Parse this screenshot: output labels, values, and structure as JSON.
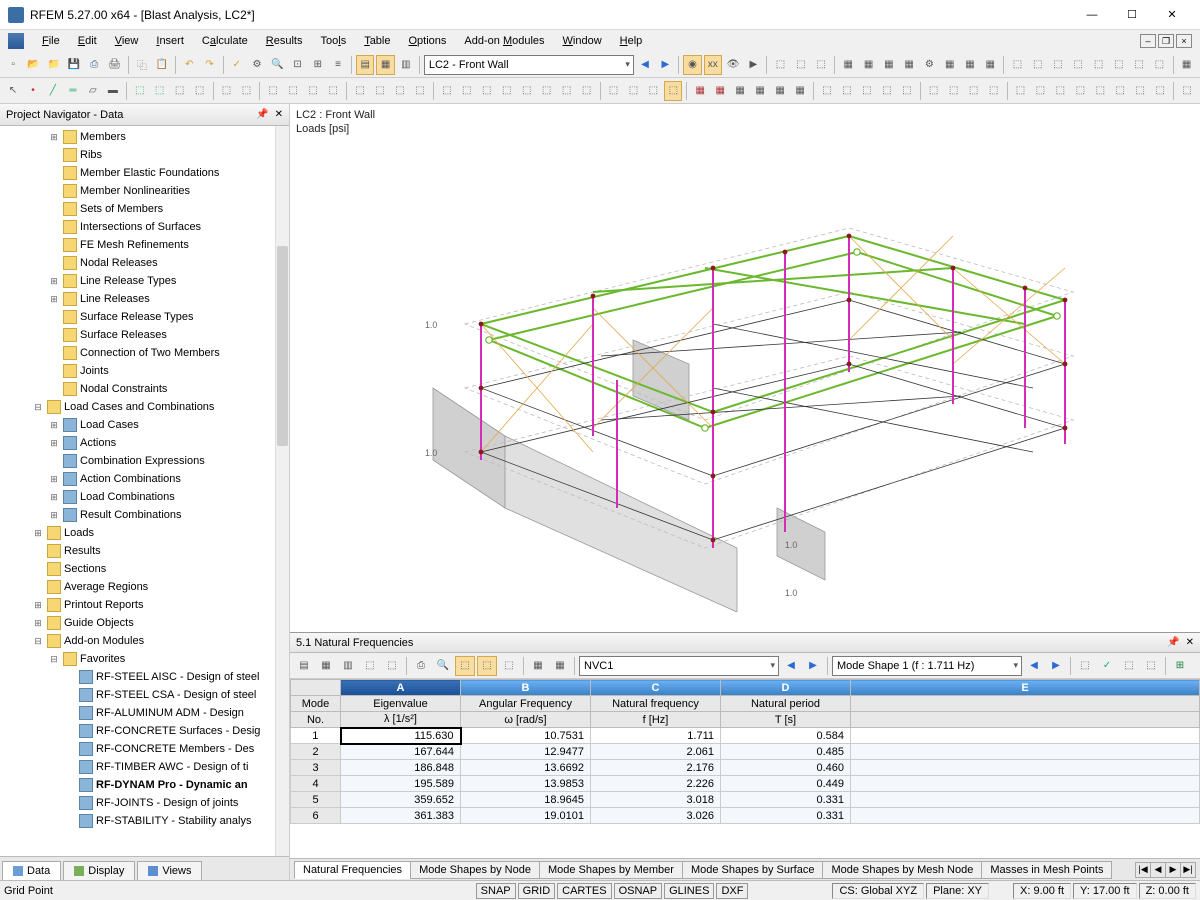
{
  "window": {
    "title": "RFEM 5.27.00 x64 - [Blast Analysis, LC2*]"
  },
  "menu": [
    "File",
    "Edit",
    "View",
    "Insert",
    "Calculate",
    "Results",
    "Tools",
    "Table",
    "Options",
    "Add-on Modules",
    "Window",
    "Help"
  ],
  "toolbar1_combo": "LC2 - Front Wall",
  "nav": {
    "title": "Project Navigator - Data",
    "items": [
      {
        "d": 3,
        "e": "+",
        "t": "Members"
      },
      {
        "d": 3,
        "e": "",
        "t": "Ribs"
      },
      {
        "d": 3,
        "e": "",
        "t": "Member Elastic Foundations"
      },
      {
        "d": 3,
        "e": "",
        "t": "Member Nonlinearities"
      },
      {
        "d": 3,
        "e": "",
        "t": "Sets of Members"
      },
      {
        "d": 3,
        "e": "",
        "t": "Intersections of Surfaces"
      },
      {
        "d": 3,
        "e": "",
        "t": "FE Mesh Refinements"
      },
      {
        "d": 3,
        "e": "",
        "t": "Nodal Releases"
      },
      {
        "d": 3,
        "e": "+",
        "t": "Line Release Types"
      },
      {
        "d": 3,
        "e": "+",
        "t": "Line Releases"
      },
      {
        "d": 3,
        "e": "",
        "t": "Surface Release Types"
      },
      {
        "d": 3,
        "e": "",
        "t": "Surface Releases"
      },
      {
        "d": 3,
        "e": "",
        "t": "Connection of Two Members"
      },
      {
        "d": 3,
        "e": "",
        "t": "Joints"
      },
      {
        "d": 3,
        "e": "",
        "t": "Nodal Constraints"
      },
      {
        "d": 2,
        "e": "-",
        "t": "Load Cases and Combinations"
      },
      {
        "d": 3,
        "e": "+",
        "t": "Load Cases",
        "m": true
      },
      {
        "d": 3,
        "e": "+",
        "t": "Actions",
        "m": true
      },
      {
        "d": 3,
        "e": "",
        "t": "Combination Expressions",
        "m": true
      },
      {
        "d": 3,
        "e": "+",
        "t": "Action Combinations",
        "m": true
      },
      {
        "d": 3,
        "e": "+",
        "t": "Load Combinations",
        "m": true
      },
      {
        "d": 3,
        "e": "+",
        "t": "Result Combinations",
        "m": true
      },
      {
        "d": 2,
        "e": "+",
        "t": "Loads"
      },
      {
        "d": 2,
        "e": "",
        "t": "Results"
      },
      {
        "d": 2,
        "e": "",
        "t": "Sections"
      },
      {
        "d": 2,
        "e": "",
        "t": "Average Regions"
      },
      {
        "d": 2,
        "e": "+",
        "t": "Printout Reports"
      },
      {
        "d": 2,
        "e": "+",
        "t": "Guide Objects"
      },
      {
        "d": 2,
        "e": "-",
        "t": "Add-on Modules"
      },
      {
        "d": 3,
        "e": "-",
        "t": "Favorites"
      },
      {
        "d": 4,
        "e": "",
        "t": "RF-STEEL AISC - Design of steel",
        "m": true
      },
      {
        "d": 4,
        "e": "",
        "t": "RF-STEEL CSA - Design of steel",
        "m": true
      },
      {
        "d": 4,
        "e": "",
        "t": "RF-ALUMINUM ADM - Design",
        "m": true
      },
      {
        "d": 4,
        "e": "",
        "t": "RF-CONCRETE Surfaces - Desig",
        "m": true
      },
      {
        "d": 4,
        "e": "",
        "t": "RF-CONCRETE Members - Des",
        "m": true
      },
      {
        "d": 4,
        "e": "",
        "t": "RF-TIMBER AWC - Design of ti",
        "m": true
      },
      {
        "d": 4,
        "e": "",
        "t": "RF-DYNAM Pro - Dynamic an",
        "m": true,
        "bold": true
      },
      {
        "d": 4,
        "e": "",
        "t": "RF-JOINTS - Design of joints",
        "m": true
      },
      {
        "d": 4,
        "e": "",
        "t": "RF-STABILITY - Stability analys",
        "m": true
      }
    ],
    "tabs": [
      "Data",
      "Display",
      "Views"
    ]
  },
  "viewport": {
    "label1": "LC2 : Front Wall",
    "label2": "Loads [psi]",
    "axis_vals": [
      "1.0",
      "1.0",
      "1.0",
      "1.0"
    ]
  },
  "panel": {
    "title": "5.1 Natural Frequencies",
    "combo1": "NVC1",
    "combo2": "Mode Shape 1 (f : 1.711 Hz)",
    "cols_top": [
      "A",
      "B",
      "C",
      "D",
      "E"
    ],
    "h1": [
      "Mode",
      "Eigenvalue",
      "Angular Frequency",
      "Natural frequency",
      "Natural period",
      ""
    ],
    "h2": [
      "No.",
      "λ [1/s²]",
      "ω [rad/s]",
      "f [Hz]",
      "T [s]",
      ""
    ],
    "rows": [
      {
        "n": "1",
        "a": "115.630",
        "b": "10.7531",
        "c": "1.711",
        "d": "0.584"
      },
      {
        "n": "2",
        "a": "167.644",
        "b": "12.9477",
        "c": "2.061",
        "d": "0.485"
      },
      {
        "n": "3",
        "a": "186.848",
        "b": "13.6692",
        "c": "2.176",
        "d": "0.460"
      },
      {
        "n": "4",
        "a": "195.589",
        "b": "13.9853",
        "c": "2.226",
        "d": "0.449"
      },
      {
        "n": "5",
        "a": "359.652",
        "b": "18.9645",
        "c": "3.018",
        "d": "0.331"
      },
      {
        "n": "6",
        "a": "361.383",
        "b": "19.0101",
        "c": "3.026",
        "d": "0.331"
      }
    ],
    "tabs": [
      "Natural Frequencies",
      "Mode Shapes by Node",
      "Mode Shapes by Member",
      "Mode Shapes by Surface",
      "Mode Shapes by Mesh Node",
      "Masses in Mesh Points"
    ]
  },
  "status": {
    "left": "Grid Point",
    "toggles": [
      "SNAP",
      "GRID",
      "CARTES",
      "OSNAP",
      "GLINES",
      "DXF"
    ],
    "cs": "CS: Global XYZ",
    "plane": "Plane: XY",
    "x": "X:   9.00 ft",
    "y": "Y:   17.00 ft",
    "z": "Z:   0.00 ft"
  }
}
